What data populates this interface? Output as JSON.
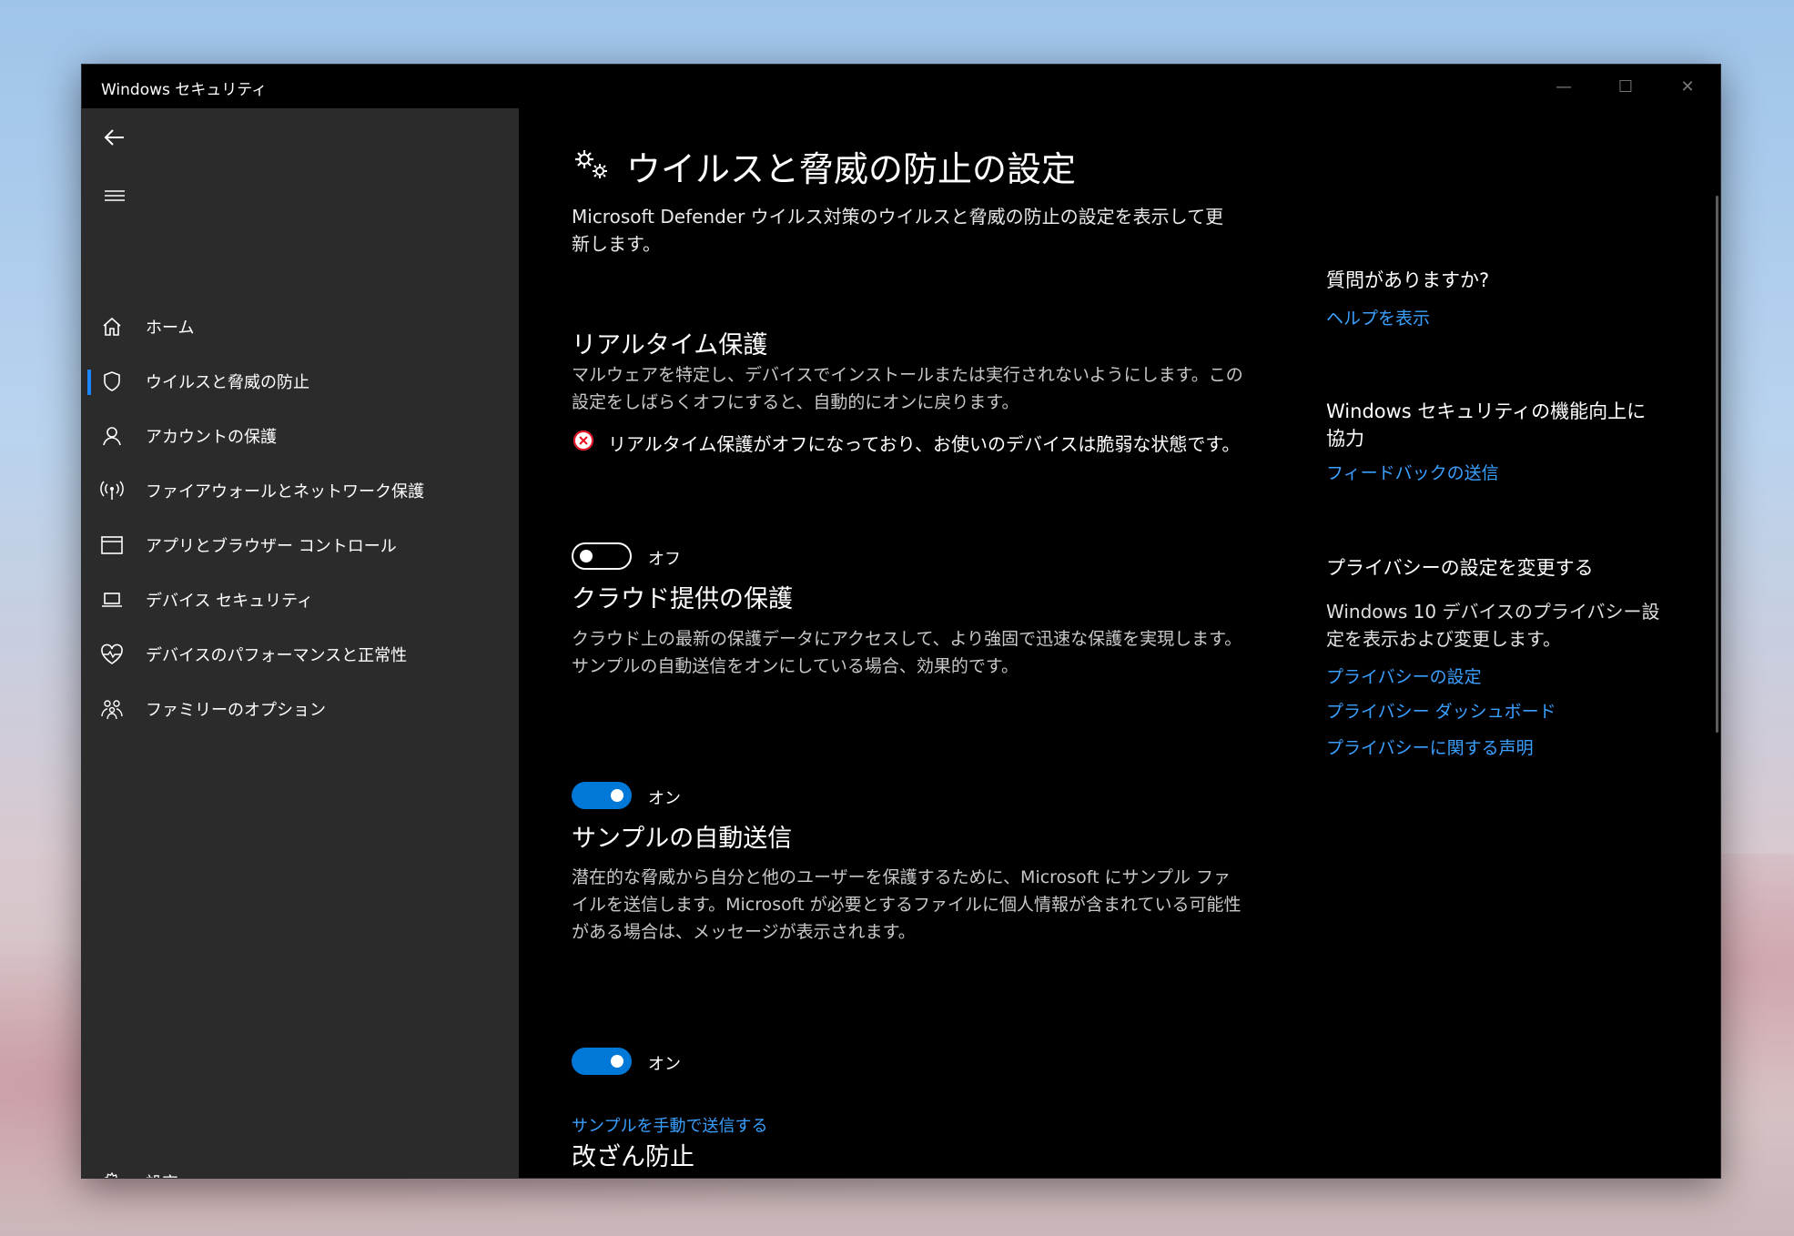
{
  "window": {
    "title": "Windows セキュリティ",
    "controls": {
      "minimize": "—",
      "maximize": "☐",
      "close": "✕"
    }
  },
  "sidebar": {
    "items": [
      {
        "label": "ホーム",
        "icon": "home-icon"
      },
      {
        "label": "ウイルスと脅威の防止",
        "icon": "shield-icon",
        "active": true
      },
      {
        "label": "アカウントの保護",
        "icon": "person-icon"
      },
      {
        "label": "ファイアウォールとネットワーク保護",
        "icon": "wireless-icon"
      },
      {
        "label": "アプリとブラウザー コントロール",
        "icon": "app-window-icon"
      },
      {
        "label": "デバイス セキュリティ",
        "icon": "laptop-icon"
      },
      {
        "label": "デバイスのパフォーマンスと正常性",
        "icon": "heart-pulse-icon"
      },
      {
        "label": "ファミリーのオプション",
        "icon": "family-icon"
      }
    ],
    "settings_label": "設定"
  },
  "main": {
    "title": "ウイルスと脅威の防止の設定",
    "description": "Microsoft Defender ウイルス対策のウイルスと脅威の防止の設定を表示して更新します。",
    "realtime": {
      "title": "リアルタイム保護",
      "description": "マルウェアを特定し、デバイスでインストールまたは実行されないようにします。この設定をしばらくオフにすると、自動的にオンに戻ります。",
      "warning": "リアルタイム保護がオフになっており、お使いのデバイスは脆弱な状態です。",
      "toggle_label": "オフ",
      "toggle_on": false
    },
    "cloud": {
      "title": "クラウド提供の保護",
      "description": "クラウド上の最新の保護データにアクセスして、より強固で迅速な保護を実現します。サンプルの自動送信をオンにしている場合、効果的です。",
      "toggle_label": "オン",
      "toggle_on": true
    },
    "sample": {
      "title": "サンプルの自動送信",
      "description": "潜在的な脅威から自分と他のユーザーを保護するために、Microsoft にサンプル ファイルを送信します。Microsoft が必要とするファイルに個人情報が含まれている可能性がある場合は、メッセージが表示されます。",
      "toggle_label": "オン",
      "toggle_on": true,
      "manual_link": "サンプルを手動で送信する"
    },
    "tamper": {
      "title": "改ざん防止"
    }
  },
  "right": {
    "question_heading": "質問がありますか?",
    "help_link": "ヘルプを表示",
    "improve_heading": "Windows セキュリティの機能向上に協力",
    "feedback_link": "フィードバックの送信",
    "privacy_heading": "プライバシーの設定を変更する",
    "privacy_desc": "Windows 10 デバイスのプライバシー設定を表示および変更します。",
    "privacy_links": [
      "プライバシーの設定",
      "プライバシー ダッシュボード",
      "プライバシーに関する声明"
    ]
  },
  "colors": {
    "accent": "#0078d7",
    "link": "#3aa0ff",
    "error": "#e81123"
  }
}
